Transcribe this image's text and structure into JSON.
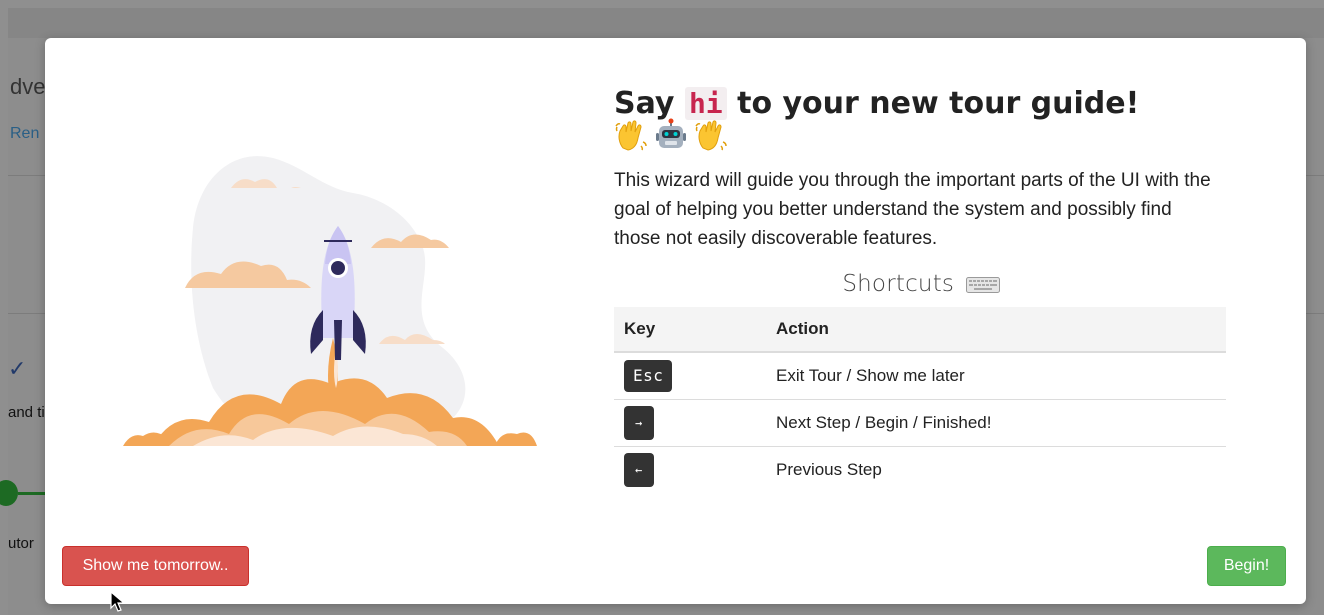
{
  "background": {
    "title_fragment": "dver",
    "link_fragment": "Ren",
    "check_icon": "check-icon",
    "row_text_fragment": "and ti",
    "step_text_fragment": "utor"
  },
  "modal": {
    "heading_prefix": "Say",
    "heading_code": "hi",
    "heading_suffix": "to your new tour guide!",
    "emojis": [
      "waving-hand-icon",
      "robot-icon",
      "waving-hand-icon"
    ],
    "intro": "This wizard will guide you through the important parts of the UI with the goal of helping you better understand the system and possibly find those not easily discoverable features.",
    "shortcuts_title": "Shortcuts",
    "shortcuts_icon": "keyboard-icon",
    "table": {
      "headers": [
        "Key",
        "Action"
      ],
      "rows": [
        {
          "key": "Esc",
          "action": "Exit Tour / Show me later"
        },
        {
          "key": "→",
          "action": "Next Step / Begin / Finished!"
        },
        {
          "key": "←",
          "action": "Previous Step"
        }
      ]
    },
    "buttons": {
      "dismiss": "Show me tomorrow..",
      "begin": "Begin!"
    }
  },
  "colors": {
    "danger": "#d9534f",
    "success": "#5cb85c",
    "code": "#c7254e"
  }
}
